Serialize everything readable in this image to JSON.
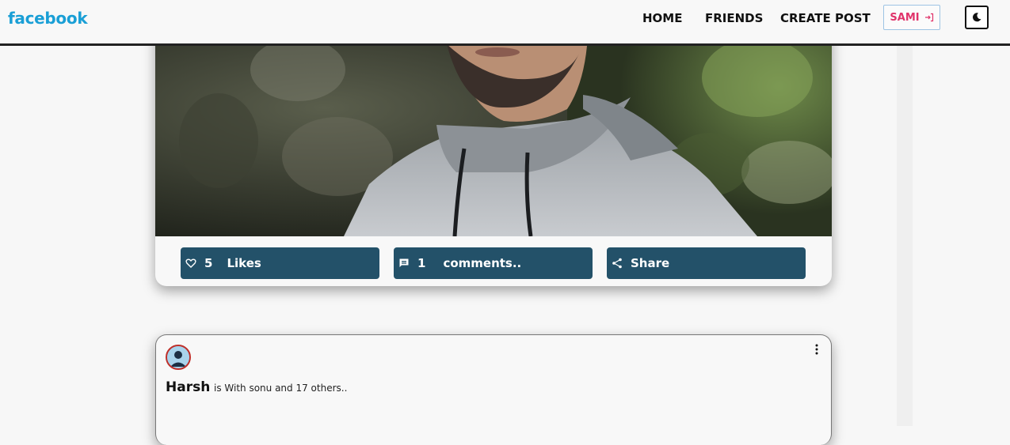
{
  "navbar": {
    "brand": "facebook",
    "links": [
      "HOME",
      "FRIENDS",
      "CREATE POST"
    ],
    "user_label": "SAMI",
    "theme_icon": "moon-icon"
  },
  "post1": {
    "image": "man-in-grey-hoodie-photo",
    "actions": {
      "likes_count": "5",
      "likes_label": "Likes",
      "comments_count": "1",
      "comments_label": "comments..",
      "share_label": "Share"
    }
  },
  "post2": {
    "author": "Harsh",
    "with_text": "is With sonu and 17 others..",
    "menu_icon": "more-vertical-icon"
  },
  "colors": {
    "brand": "#1a9fd6",
    "action_bg": "#235169",
    "user_label": "#e0336a"
  }
}
